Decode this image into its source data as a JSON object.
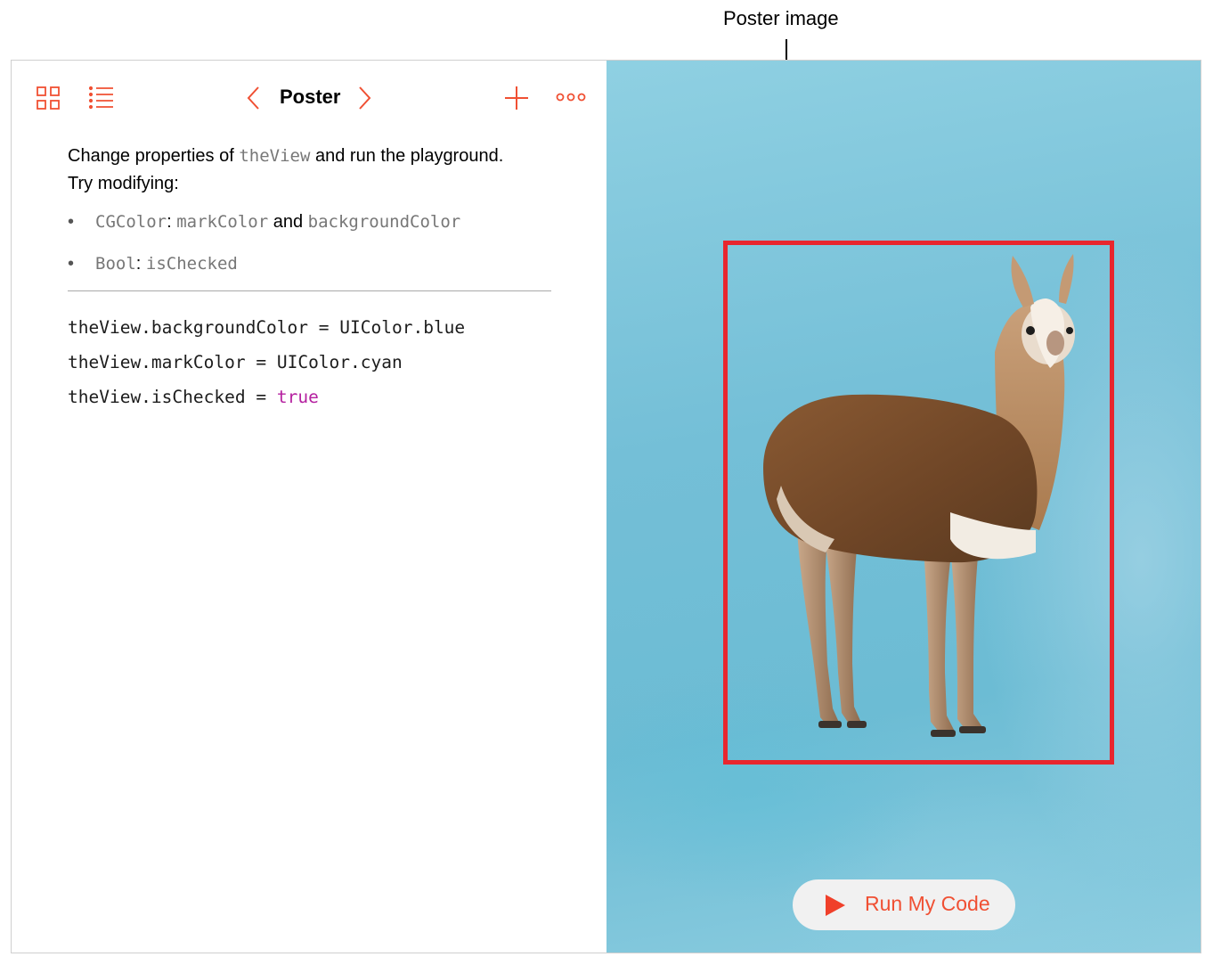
{
  "callout": {
    "label": "Poster image"
  },
  "toolbar": {
    "title": "Poster",
    "icons": [
      "grid-icon",
      "list-icon",
      "chevron-left-icon",
      "chevron-right-icon",
      "plus-icon",
      "more-icon"
    ]
  },
  "instructions": {
    "intro_before": "Change properties of",
    "intro_code": "theView",
    "intro_after": "and run the playground.",
    "intro_line2": "Try modifying:",
    "bullets": [
      {
        "type": "CGColor",
        "colon": ":",
        "prop1": "markColor",
        "joiner": "and",
        "prop2": "backgroundColor"
      },
      {
        "type": "Bool",
        "colon": ":",
        "prop1": "isChecked"
      }
    ]
  },
  "code": {
    "line1_lhs": "theView.backgroundColor",
    "line1_eq": "=",
    "line1_rhs": "UIColor.blue",
    "line2_lhs": "theView.markColor",
    "line2_eq": "=",
    "line2_rhs": "UIColor.cyan",
    "line3_lhs": "theView.isChecked",
    "line3_eq": "=",
    "line3_rhs": "true"
  },
  "live_view": {
    "poster_subject": "llama-image",
    "run_button_label": "Run My Code"
  },
  "colors": {
    "accent": "#f05033",
    "highlight_box": "#e8262e",
    "keyword": "#b521a0",
    "live_view_background": "#74bfd7"
  }
}
